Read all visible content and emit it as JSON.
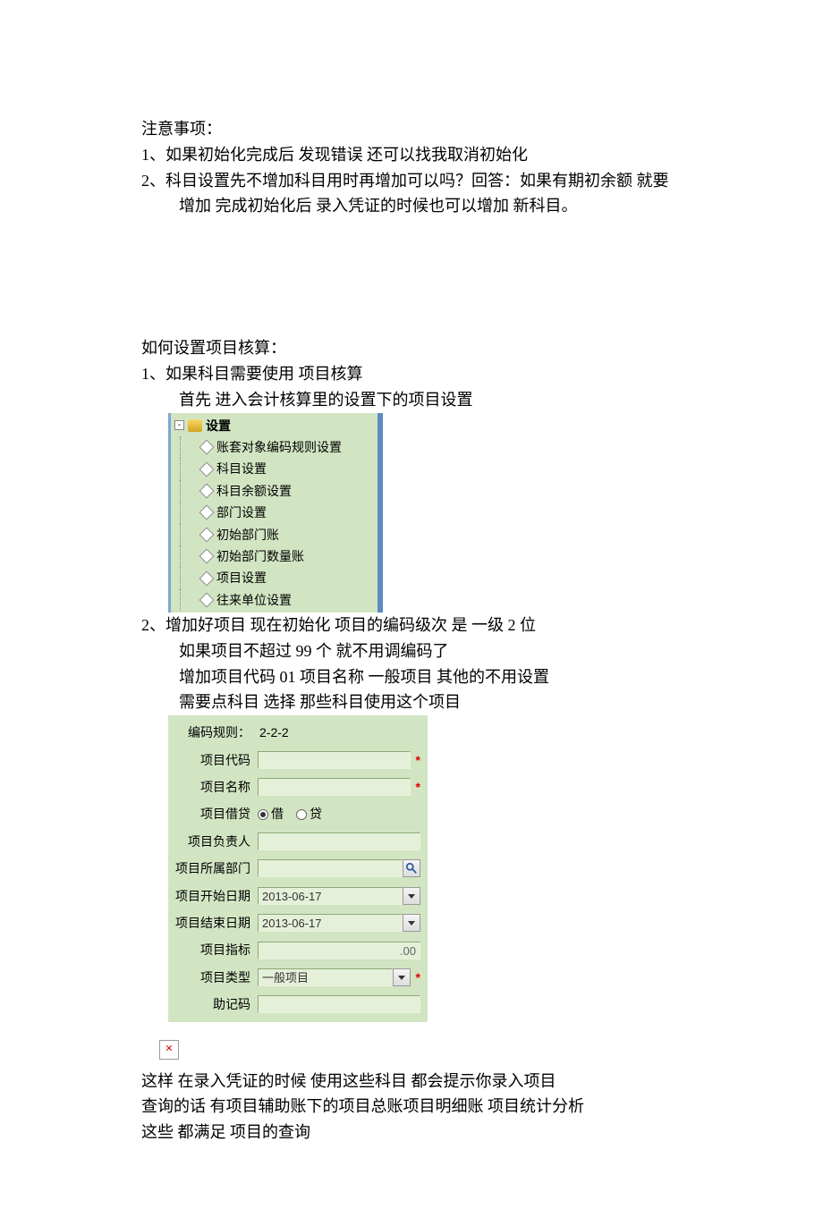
{
  "notes": {
    "heading": "注意事项：",
    "item1": "1、如果初始化完成后 发现错误   还可以找我取消初始化",
    "item2": "2、科目设置先不增加科目用时再增加可以吗？回答：如果有期初余额 就要",
    "item2b": "增加     完成初始化后 录入凭证的时候也可以增加 新科目。"
  },
  "howto": {
    "heading": "如何设置项目核算：",
    "step1_line1": "1、如果科目需要使用      项目核算",
    "step1_line2": "首先   进入会计核算里的设置下的项目设置",
    "step2_line1": "2、增加好项目   现在初始化      项目的编码级次   是   一级 2 位",
    "step2_line2": "如果项目不超过 99 个    就不用调编码了",
    "step2_line3": "增加项目代码   01           项目名称     一般项目         其他的不用设置",
    "step2_line4": "需要点科目   选择   那些科目使用这个项目"
  },
  "tree": {
    "root": "设置",
    "items": [
      "账套对象编码规则设置",
      "科目设置",
      "科目余额设置",
      "部门设置",
      "初始部门账",
      "初始部门数量账",
      "项目设置",
      "往来单位设置"
    ]
  },
  "form": {
    "rule_label": "编码规则：",
    "rule_value": "2-2-2",
    "code_label": "项目代码",
    "name_label": "项目名称",
    "drcr_label": "项目借贷",
    "dr": "借",
    "cr": "贷",
    "owner_label": "项目负责人",
    "dept_label": "项目所属部门",
    "start_label": "项目开始日期",
    "start_value": "2013-06-17",
    "end_label": "项目结束日期",
    "end_value": "2013-06-17",
    "target_label": "项目指标",
    "target_value": ".00",
    "type_label": "项目类型",
    "type_value": "一般项目",
    "mnem_label": "助记码"
  },
  "tail": {
    "l1": "这样   在录入凭证的时候   使用这些科目   都会提示你录入项目",
    "l2": "查询的话   有项目辅助账下的项目总账项目明细账 项目统计分析",
    "l3": "这些   都满足   项目的查询"
  }
}
